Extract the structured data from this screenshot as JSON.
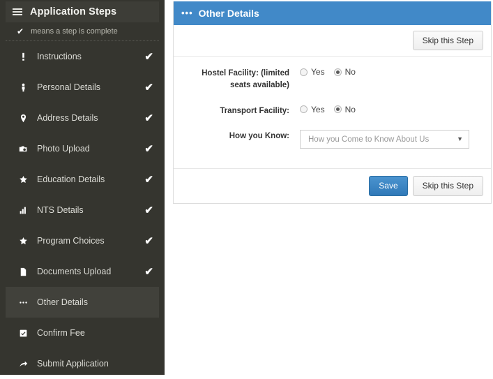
{
  "sidebar": {
    "menu_icon": "hamburger-icon",
    "title": "Application Steps",
    "legend": {
      "check": "✔",
      "text": "means a step is complete"
    },
    "steps": [
      {
        "icon": "exclamation-icon",
        "label": "Instructions",
        "complete": "✔",
        "active": false
      },
      {
        "icon": "person-icon",
        "label": "Personal Details",
        "complete": "✔",
        "active": false
      },
      {
        "icon": "map-pin-icon",
        "label": "Address Details",
        "complete": "✔",
        "active": false
      },
      {
        "icon": "camera-icon",
        "label": "Photo Upload",
        "complete": "✔",
        "active": false
      },
      {
        "icon": "star-icon",
        "label": "Education Details",
        "complete": "✔",
        "active": false
      },
      {
        "icon": "bar-chart-icon",
        "label": "NTS Details",
        "complete": "✔",
        "active": false
      },
      {
        "icon": "star-icon",
        "label": "Program Choices",
        "complete": "✔",
        "active": false
      },
      {
        "icon": "document-icon",
        "label": "Documents Upload",
        "complete": "✔",
        "active": false
      },
      {
        "icon": "ellipsis-icon",
        "label": "Other Details",
        "complete": "",
        "active": true
      },
      {
        "icon": "checkbox-icon",
        "label": "Confirm Fee",
        "complete": "",
        "active": false
      },
      {
        "icon": "arrow-icon",
        "label": "Submit Application",
        "complete": "",
        "active": false
      }
    ]
  },
  "panel": {
    "header": {
      "icon": "ellipsis-icon",
      "title": "Other Details"
    },
    "top_skip_label": "Skip this Step",
    "fields": [
      {
        "label": "Hostel Facility: (limited seats available)",
        "type": "radio",
        "options": [
          "Yes",
          "No"
        ],
        "selected": "No"
      },
      {
        "label": "Transport Facility:",
        "type": "radio",
        "options": [
          "Yes",
          "No"
        ],
        "selected": "No"
      },
      {
        "label": "How you Know:",
        "type": "select",
        "placeholder": "How you Come to Know About Us",
        "caret": "▼"
      }
    ],
    "footer": {
      "save_label": "Save",
      "skip_label": "Skip this Step"
    }
  },
  "colors": {
    "sidebar_bg": "#35352f",
    "sidebar_active": "#41413b",
    "header_blue": "#4189c8",
    "primary_button": "#3079b8",
    "page_bg": "#ffffff"
  }
}
